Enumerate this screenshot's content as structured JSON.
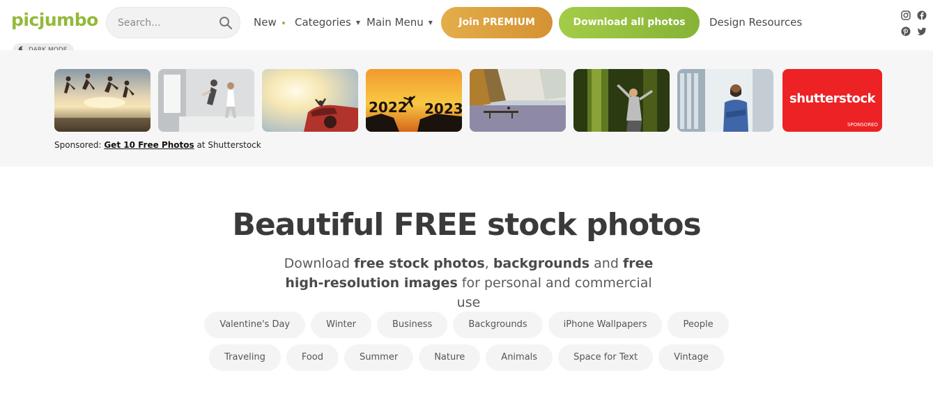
{
  "header": {
    "logo": "picjumbo",
    "search": {
      "placeholder": "Search..."
    },
    "nav": [
      {
        "label": "New"
      },
      {
        "label": "Categories"
      },
      {
        "label": "Main Menu"
      }
    ],
    "join_premium": "Join PREMIUM",
    "download_all": "Download all photos",
    "design_resources": "Design Resources",
    "social_icons": [
      "instagram-icon",
      "facebook-icon",
      "pinterest-icon",
      "twitter-icon"
    ],
    "dark_mode": "DARK MODE"
  },
  "sponsored": {
    "thumbnails": [
      {
        "id": "friends-beach-jump"
      },
      {
        "id": "couple-bed-jump"
      },
      {
        "id": "woman-red-car-sunset"
      },
      {
        "id": "new-year",
        "text_left": "2022",
        "text_right": "2023"
      },
      {
        "id": "lake-dock"
      },
      {
        "id": "woman-forest"
      },
      {
        "id": "man-city"
      },
      {
        "id": "shutterstock-ad",
        "brand": "shutterstock",
        "badge": "SPONSORED"
      }
    ],
    "prefix": "Sponsored:",
    "link": "Get 10 Free Photos",
    "suffix": "at Shutterstock"
  },
  "hero": {
    "title": "Beautiful FREE stock photos",
    "sub_1": "Download ",
    "sub_2": "free stock photos",
    "sub_3": ", ",
    "sub_4": "backgrounds",
    "sub_5": " and ",
    "sub_6": "free high-resolution images",
    "sub_7": " for personal and commercial use"
  },
  "tags": {
    "row1": [
      "Valentine's Day",
      "Winter",
      "Business",
      "Backgrounds",
      "iPhone Wallpapers",
      "People"
    ],
    "row2": [
      "Traveling",
      "Food",
      "Summer",
      "Nature",
      "Animals",
      "Space for Text",
      "Vintage"
    ]
  },
  "colors": {
    "brand_green": "#94b93a",
    "premium_orange": "#dca043",
    "shutterstock_red": "#ed2224"
  }
}
